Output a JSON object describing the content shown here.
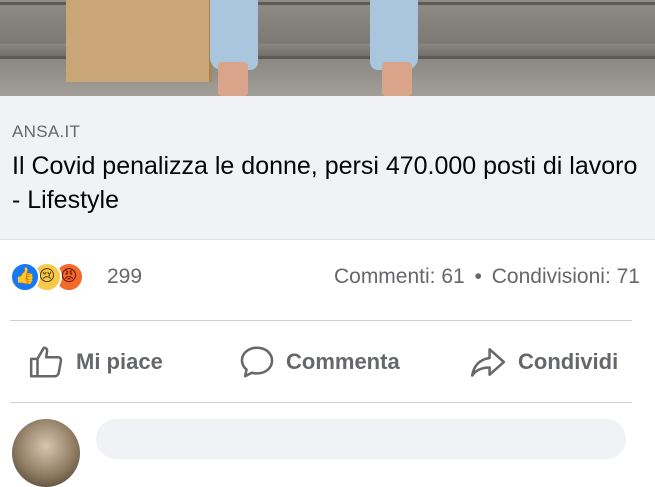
{
  "link_preview": {
    "domain": "ANSA.IT",
    "headline": "Il Covid penalizza le donne, persi 470.000 posti di lavoro - Lifestyle"
  },
  "reactions": {
    "icons": [
      "like-icon",
      "sad-icon",
      "angry-icon"
    ],
    "count": "299",
    "comments": "Commenti: 61",
    "separator": "•",
    "shares": "Condivisioni: 71"
  },
  "actions": {
    "like_label": "Mi piace",
    "comment_label": "Commenta",
    "share_label": "Condividi"
  },
  "colors": {
    "like_blue": "#1877f2",
    "text_secondary": "#65676b",
    "preview_bg": "#f0f2f5"
  }
}
